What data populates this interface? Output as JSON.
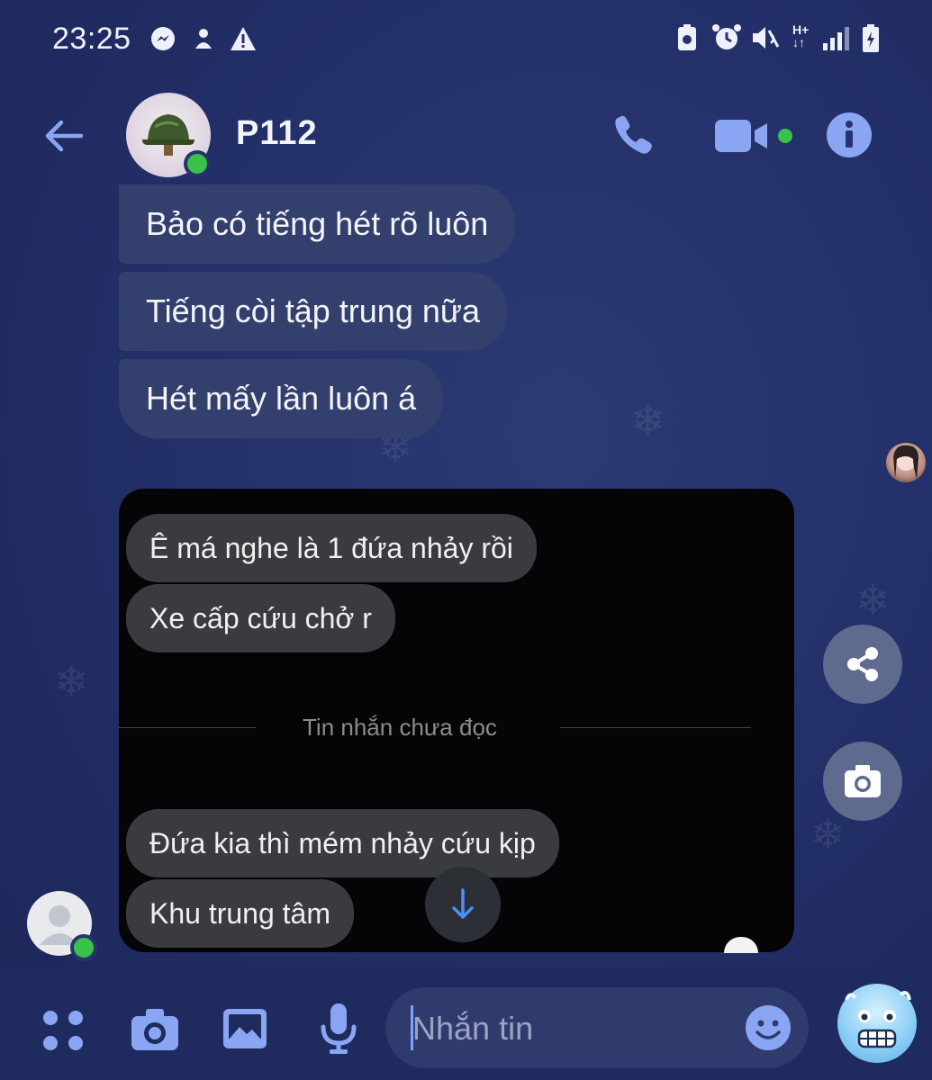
{
  "status_bar": {
    "time": "23:25",
    "left_icons": [
      "messenger-icon",
      "notification-icon",
      "warning-icon"
    ],
    "right_icons": [
      "battery-saver-icon",
      "alarm-icon",
      "mute-icon",
      "network-icon",
      "signal-icon",
      "battery-icon"
    ],
    "network_label": "H+"
  },
  "header": {
    "contact_name": "P112",
    "online": true
  },
  "messages": [
    {
      "text": "Bảo có tiếng hét rõ luôn"
    },
    {
      "text": "Tiếng còi tập trung nữa"
    },
    {
      "text": "Hét mấy lần luôn á"
    }
  ],
  "screenshot": {
    "messages_before": [
      {
        "text": "Ê má nghe là 1 đứa nhảy rồi"
      },
      {
        "text": "Xe cấp cứu chở r"
      }
    ],
    "unread_divider": "Tin nhắn chưa đọc",
    "messages_after": [
      {
        "text": "Đứa kia thì mém nhảy cứu kịp"
      },
      {
        "text": "Khu trung tâm"
      }
    ]
  },
  "composer": {
    "placeholder": "Nhắn tin"
  },
  "colors": {
    "accent": "#7ea2ff",
    "online": "#39c24a",
    "background": "#24306a",
    "bubble": "#33406e"
  }
}
